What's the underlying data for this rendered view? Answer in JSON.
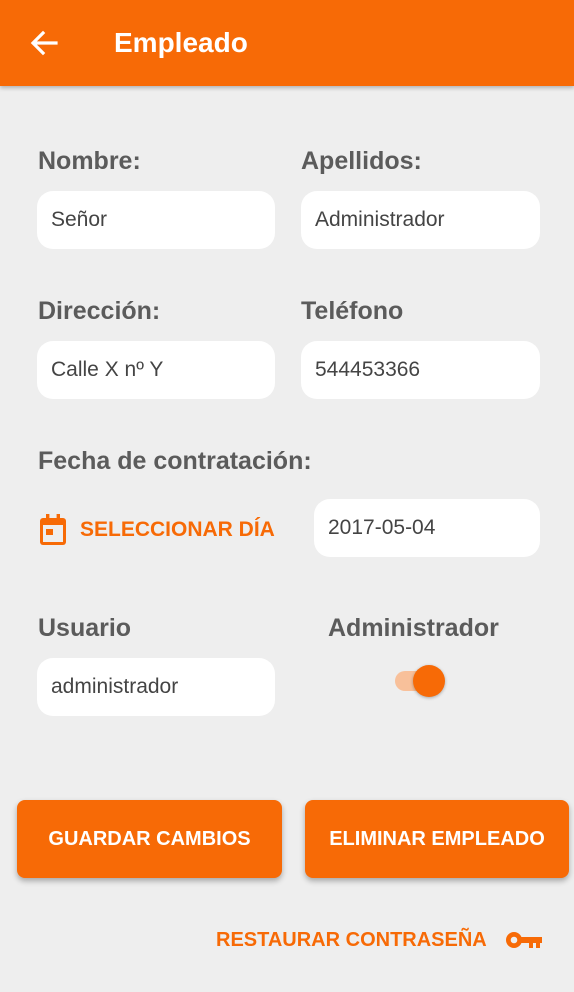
{
  "colors": {
    "primary": "#f76a06",
    "background": "#eeeeee",
    "field_bg": "#ffffff",
    "label_text": "#5b5b5b"
  },
  "appbar": {
    "back_icon": "arrow-left-icon",
    "title": "Empleado"
  },
  "form": {
    "nombre": {
      "label": "Nombre:",
      "value": "Señor"
    },
    "apellidos": {
      "label": "Apellidos:",
      "value": "Administrador"
    },
    "direccion": {
      "label": "Dirección:",
      "value": "Calle X nº Y"
    },
    "telefono": {
      "label": "Teléfono",
      "value": "544453366"
    },
    "fecha": {
      "label": "Fecha de contratación:",
      "select_label": "SELECCIONAR DÍA",
      "select_icon": "calendar-icon",
      "value": "2017-05-04"
    },
    "usuario": {
      "label": "Usuario",
      "value": "administrador"
    },
    "administrador": {
      "label": "Administrador",
      "checked": true
    }
  },
  "actions": {
    "save_label": "GUARDAR CAMBIOS",
    "delete_label": "ELIMINAR EMPLEADO",
    "restore_label": "RESTAURAR CONTRASEÑA",
    "restore_icon": "key-icon"
  }
}
